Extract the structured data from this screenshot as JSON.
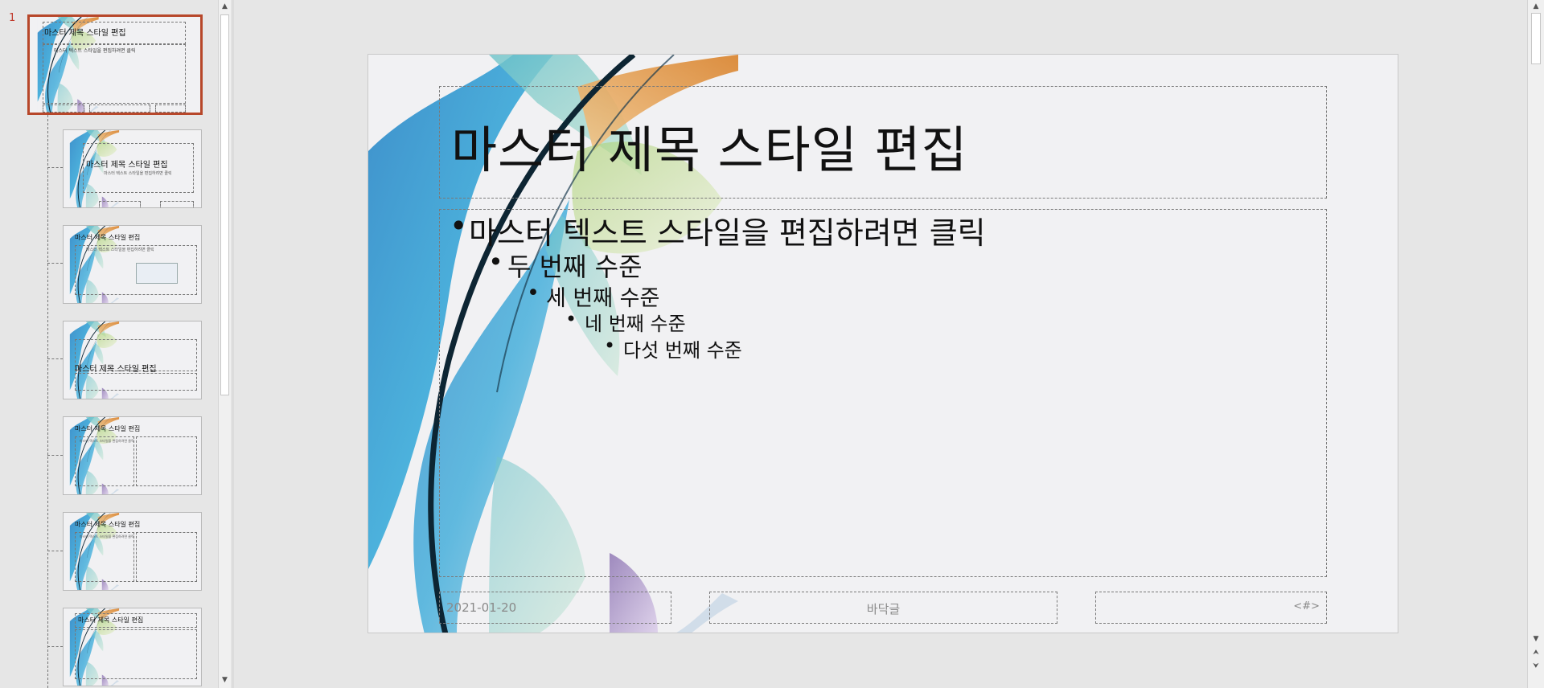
{
  "thumbnails": {
    "master_number": "1",
    "master_title": "마스터 제목 스타일 편집",
    "master_subtitle": "마스터 텍스트 스타일을 편집하려면 클릭",
    "layouts": [
      {
        "title": "마스터 제목 스타일 편집",
        "subtitle": "마스터 텍스트 스타일을 편집하려면 클릭"
      },
      {
        "title": "마스터 제목 스타일 편집",
        "subtitle": "마스터 텍스트 스타일을 편집하려면 클릭"
      },
      {
        "title": "마스터 제목 스타일 편집",
        "subtitle": ""
      },
      {
        "title": "마스터 제목 스타일 편집",
        "subtitle": "마스터 텍스트 스타일을 편집하려면 클릭"
      },
      {
        "title": "마스터 제목 스타일 편집",
        "subtitle": "마스터 텍스트 스타일을 편집하려면 클릭"
      },
      {
        "title": "마스터 제목 스타일 편집",
        "subtitle": ""
      }
    ]
  },
  "slide": {
    "title": "마스터 제목 스타일 편집",
    "levels": [
      "마스터 텍스트 스타일을 편집하려면 클릭",
      "두 번째 수준",
      "세 번째 수준",
      "네 번째 수준",
      "다섯 번째 수준"
    ],
    "footer": {
      "date": "2021-01-20",
      "center": "바닥글",
      "page": "<#>"
    }
  },
  "scroll_icons": {
    "up": "▲",
    "down": "▼",
    "prev_slide": "⮝",
    "next_slide": "⮟"
  },
  "colors": {
    "selection_border": "#b7472a",
    "slide_number": "#c0392b"
  }
}
